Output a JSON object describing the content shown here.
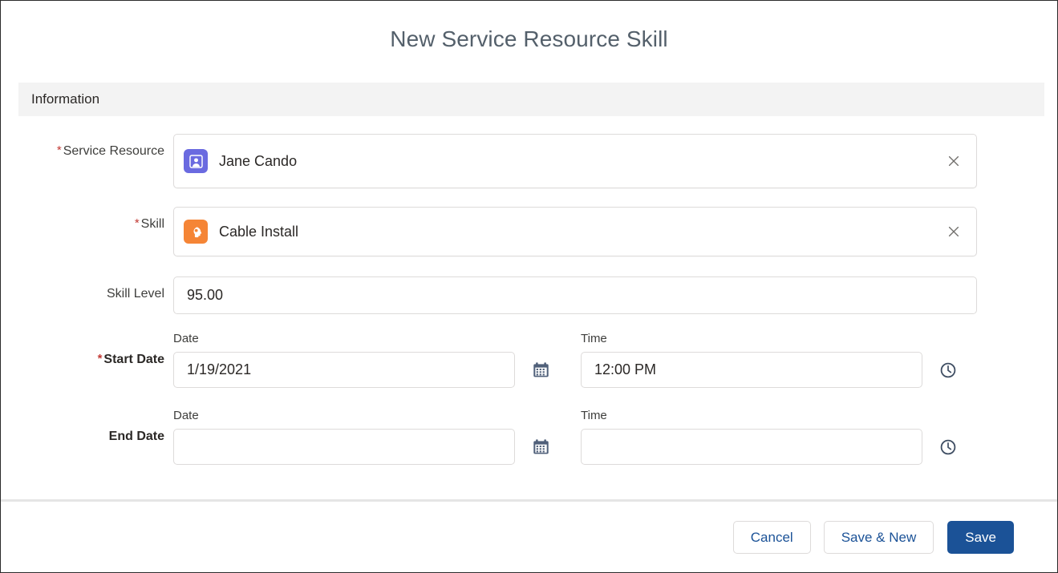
{
  "modal": {
    "title": "New Service Resource Skill",
    "section": {
      "title": "Information"
    }
  },
  "fields": {
    "service_resource": {
      "label": "Service Resource",
      "required": true,
      "value": "Jane Cando",
      "icon": "service-resource-avatar-icon",
      "icon_color": "#6a6ae0",
      "clear_icon": "close-icon"
    },
    "skill": {
      "label": "Skill",
      "required": true,
      "value": "Cable Install",
      "icon": "skill-head-icon",
      "icon_color": "#f58536",
      "clear_icon": "close-icon"
    },
    "skill_level": {
      "label": "Skill Level",
      "required": false,
      "value": "95.00",
      "placeholder": ""
    },
    "start_date": {
      "label": "Start Date",
      "required": true,
      "date_sublabel": "Date",
      "date_value": "1/19/2021",
      "date_placeholder": "",
      "date_icon": "calendar-icon",
      "time_sublabel": "Time",
      "time_value": "12:00 PM",
      "time_placeholder": "",
      "time_icon": "clock-icon"
    },
    "end_date": {
      "label": "End Date",
      "required": false,
      "date_sublabel": "Date",
      "date_value": "",
      "date_placeholder": "",
      "date_icon": "calendar-icon",
      "time_sublabel": "Time",
      "time_value": "",
      "time_placeholder": "",
      "time_icon": "clock-icon"
    }
  },
  "footer": {
    "cancel_label": "Cancel",
    "save_new_label": "Save & New",
    "save_label": "Save"
  },
  "colors": {
    "brand_blue": "#1b5297",
    "required_red": "#c23934",
    "icon_blue": "#50607a",
    "section_bg": "#f3f3f3"
  }
}
